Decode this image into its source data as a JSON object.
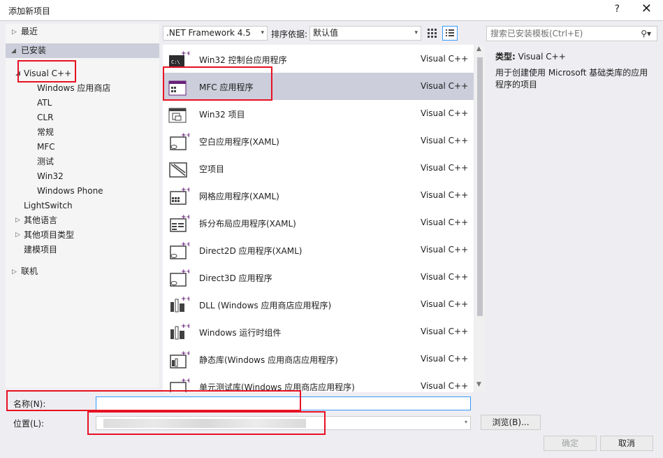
{
  "dialog": {
    "title": "添加新项目",
    "help": "?",
    "close": "✕"
  },
  "tree": [
    {
      "label": "最近",
      "arrow": "▷"
    },
    {
      "label": "已安装",
      "arrow": "◢"
    },
    {
      "label": "Visual C++",
      "arrow": "◢"
    },
    {
      "label": "Windows 应用商店"
    },
    {
      "label": "ATL"
    },
    {
      "label": "CLR"
    },
    {
      "label": "常规"
    },
    {
      "label": "MFC"
    },
    {
      "label": "测试"
    },
    {
      "label": "Win32"
    },
    {
      "label": "Windows Phone"
    },
    {
      "label": "LightSwitch"
    },
    {
      "label": "其他语言",
      "arrow": "▷"
    },
    {
      "label": "其他项目类型",
      "arrow": "▷"
    },
    {
      "label": "建模项目"
    },
    {
      "label": "联机",
      "arrow": "▷"
    }
  ],
  "toolbar": {
    "framework": ".NET Framework 4.5",
    "sort_label": "排序依据:",
    "sort_value": "默认值"
  },
  "search": {
    "placeholder": "搜索已安装模板(Ctrl+E)",
    "icon": "search-icon"
  },
  "templates": [
    {
      "name": "Win32 控制台应用程序",
      "lang": "Visual C++"
    },
    {
      "name": "MFC 应用程序",
      "lang": "Visual C++"
    },
    {
      "name": "Win32 项目",
      "lang": "Visual C++"
    },
    {
      "name": "空白应用程序(XAML)",
      "lang": "Visual C++"
    },
    {
      "name": "空项目",
      "lang": "Visual C++"
    },
    {
      "name": "网格应用程序(XAML)",
      "lang": "Visual C++"
    },
    {
      "name": "拆分布局应用程序(XAML)",
      "lang": "Visual C++"
    },
    {
      "name": "Direct2D 应用程序(XAML)",
      "lang": "Visual C++"
    },
    {
      "name": "Direct3D 应用程序",
      "lang": "Visual C++"
    },
    {
      "name": "DLL (Windows 应用商店应用程序)",
      "lang": "Visual C++"
    },
    {
      "name": "Windows 运行时组件",
      "lang": "Visual C++"
    },
    {
      "name": "静态库(Windows 应用商店应用程序)",
      "lang": "Visual C++"
    },
    {
      "name": "单元测试库(Windows 应用商店应用程序)",
      "lang": "Visual C++"
    }
  ],
  "info": {
    "type_label": "类型:",
    "type_value": "Visual C++",
    "description": "用于创建使用 Microsoft 基础类库的应用程序的项目"
  },
  "form": {
    "name_label": "名称(N):",
    "name_value": "",
    "location_label": "位置(L):",
    "browse": "浏览(B)...",
    "ok": "确定",
    "cancel": "取消"
  },
  "colors": {
    "selection": "#cccedb",
    "highlight": "#e81123",
    "accent": "#68217a"
  }
}
